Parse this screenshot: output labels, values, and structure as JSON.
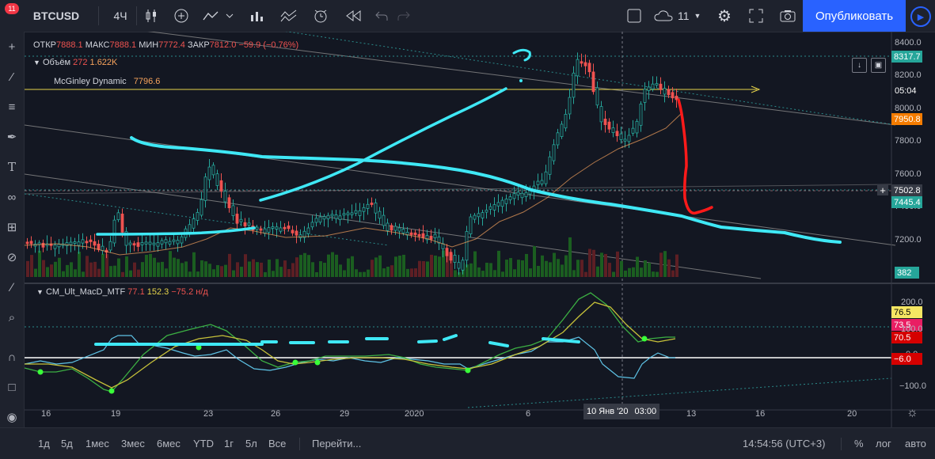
{
  "toolbar": {
    "symbol": "BTCUSD",
    "interval": "4Ч",
    "layout_count": "11",
    "publish_label": "Опубликовать",
    "notification_count": "11"
  },
  "ohlc": {
    "open_label": "ОТКР",
    "open": "7888.1",
    "high_label": "МАКС",
    "high": "7888.1",
    "low_label": "МИН",
    "low": "7772.4",
    "close_label": "ЗАКР",
    "close": "7812.0",
    "change": "−59.9 (−0.76%)"
  },
  "volume_legend": {
    "name": "Объём",
    "v1": "272",
    "v2": "1.622K"
  },
  "mcginley_legend": {
    "name": "McGinley Dynamic",
    "value": "7796.6"
  },
  "macd_legend": {
    "name": "CM_Ult_MacD_MTF",
    "v1": "77.1",
    "v2": "152.3",
    "v3": "−75.2",
    "v4": "н/д"
  },
  "price_axis": [
    "8400.0",
    "8200.0",
    "8000.0",
    "7800.0",
    "7600.0",
    "7400.0",
    "7200.0"
  ],
  "price_axis_markers": {
    "high": "8317.7",
    "countdown": "05:04",
    "last": "7950.8",
    "crosshair": "7502.8",
    "mcginley": "7445.4",
    "volume": "382"
  },
  "macd_axis": [
    "200.0",
    "100.0",
    "0.0",
    "−100.0"
  ],
  "macd_axis_markers": [
    "76.5",
    "73.5",
    "70.5",
    "−6.0"
  ],
  "time_axis": [
    "16",
    "19",
    "23",
    "26",
    "29",
    "2020",
    "6",
    "13",
    "16",
    "20"
  ],
  "time_crosshair": {
    "date": "10 Янв '20",
    "time": "03:00"
  },
  "bottombar": {
    "ranges": [
      "1д",
      "5д",
      "1мес",
      "3мес",
      "6мес",
      "YTD",
      "1г",
      "5л",
      "Все"
    ],
    "goto": "Перейти...",
    "clock": "14:54:56 (UTC+3)",
    "percent": "%",
    "log": "лог",
    "auto": "авто"
  },
  "colors": {
    "up": "#26a69a",
    "down": "#ef5350",
    "drawing_cyan": "#3fe8f5",
    "drawing_red": "#ff1a1a",
    "publish": "#2962ff",
    "mcginley": "#f7a35c",
    "level": "#e6d34a"
  },
  "icons": {
    "left": [
      "crosshair-icon",
      "trendline-icon",
      "fib-icon",
      "brush-icon",
      "text-icon",
      "pattern-icon",
      "projection-icon",
      "eraser-icon",
      "ruler-icon",
      "zoom-icon",
      "magnet-icon",
      "lock-icon",
      "eye-icon",
      "trash-icon"
    ],
    "top": [
      "candles-icon",
      "add-compare-icon",
      "indicator-icon",
      "financials-icon",
      "templates-icon",
      "alert-icon",
      "replay-icon",
      "undo-icon",
      "redo-icon",
      "layout-icon",
      "cloud-icon",
      "settings-icon",
      "fullscreen-icon",
      "camera-icon",
      "play-icon"
    ]
  }
}
